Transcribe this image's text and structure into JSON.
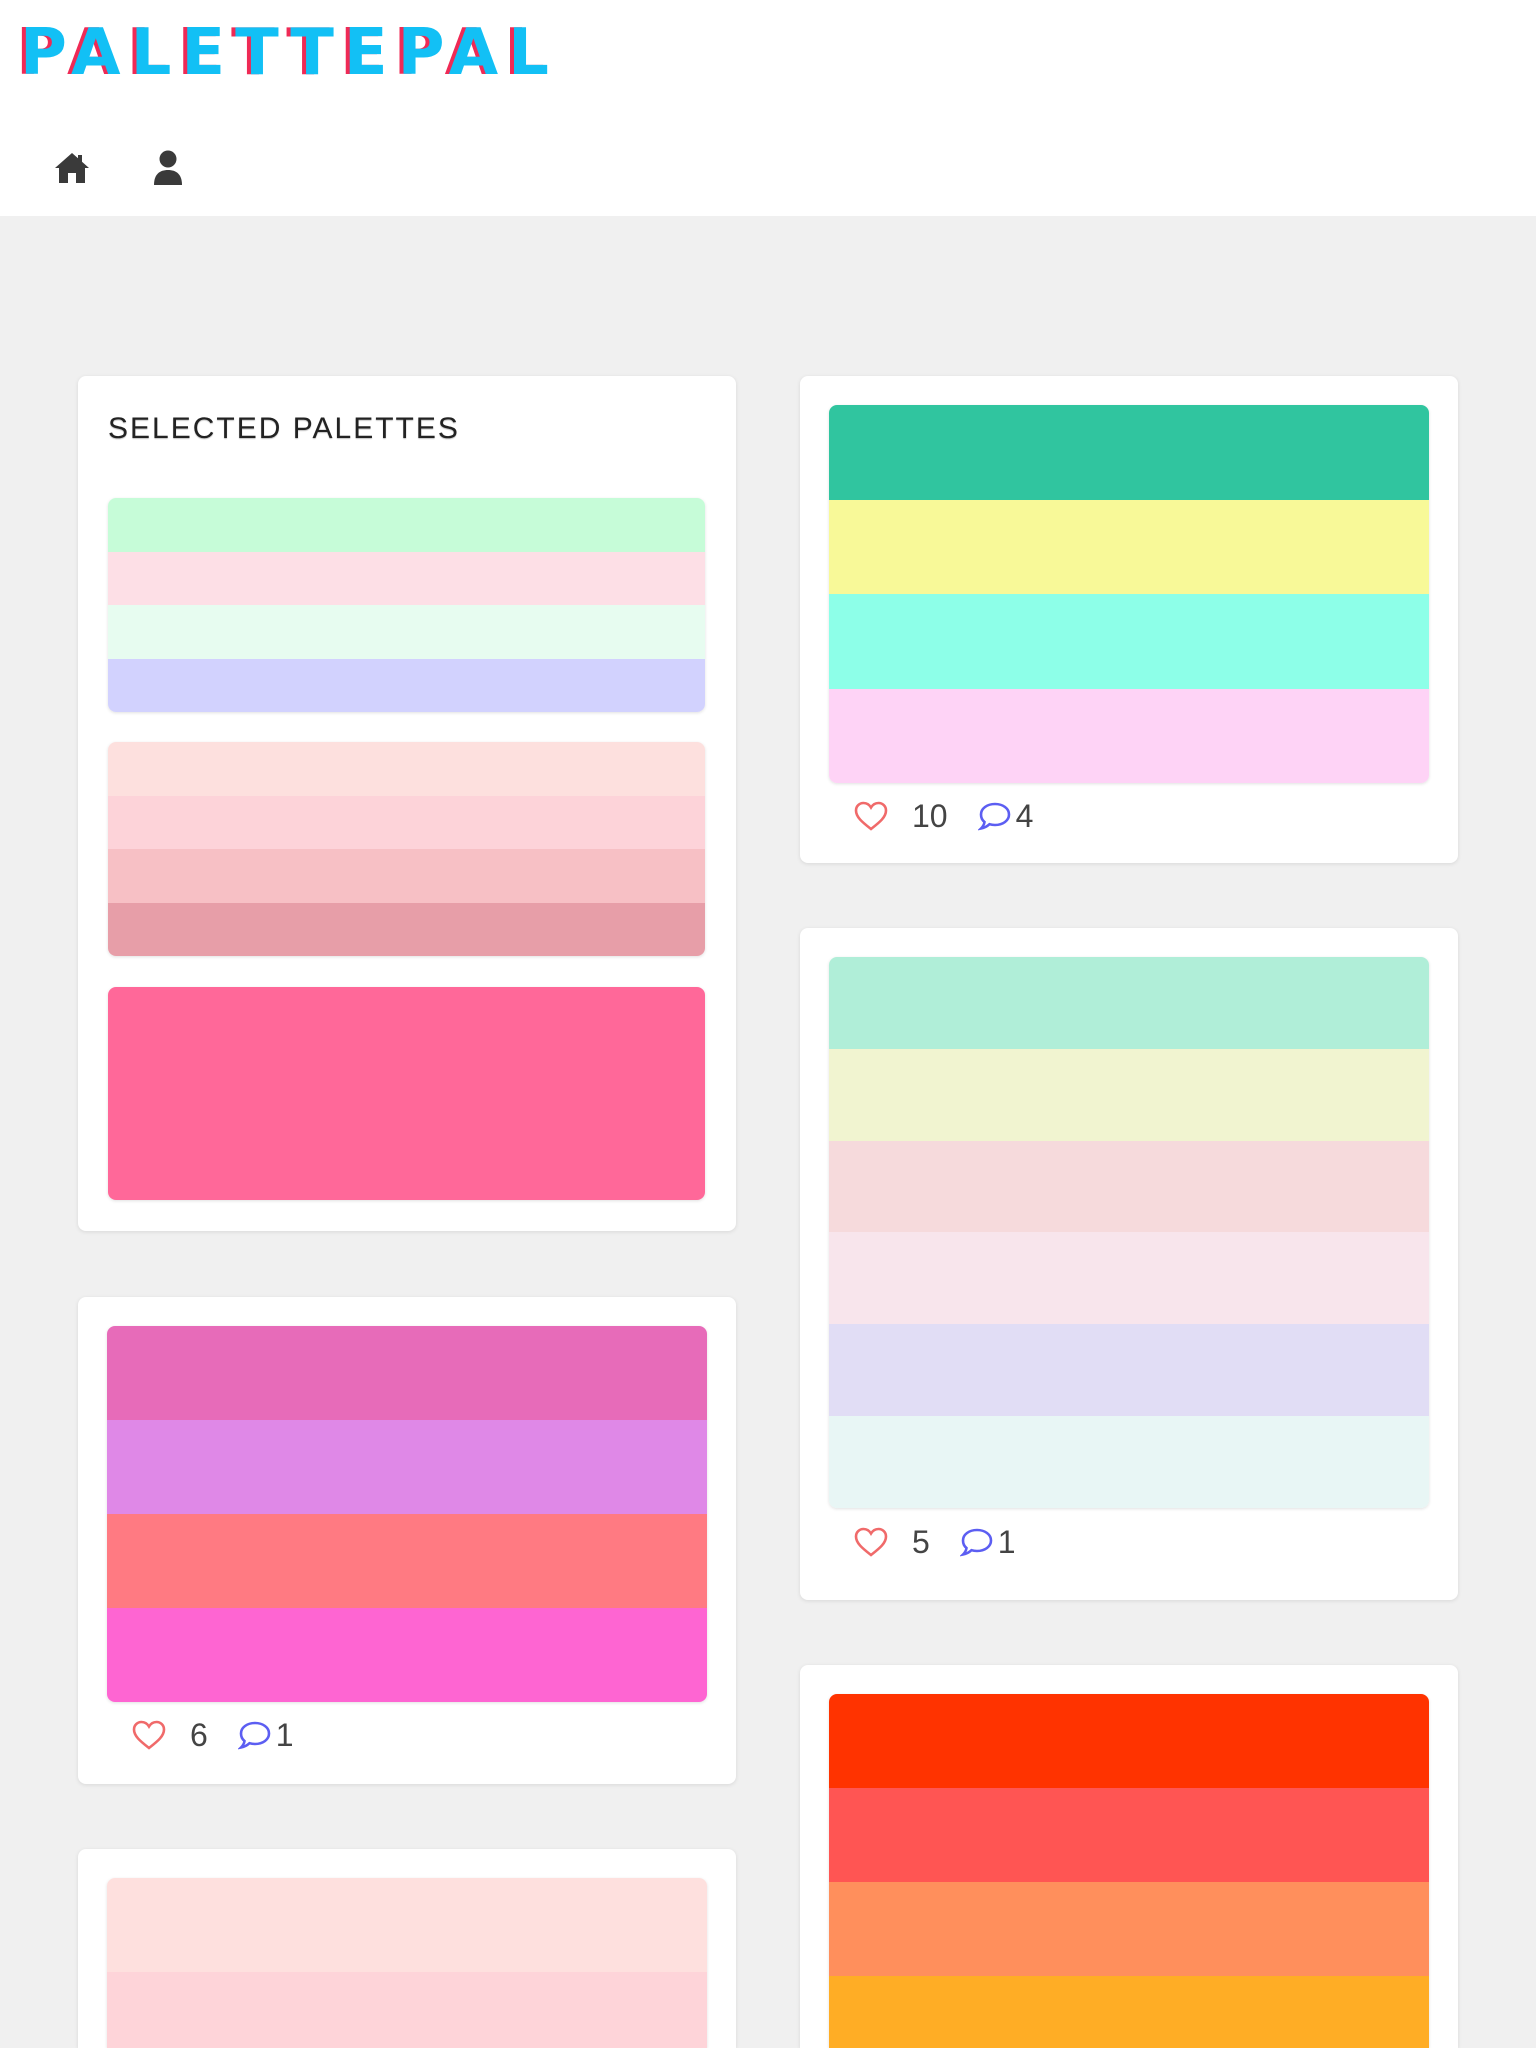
{
  "app": {
    "logo_text": "PALETTEPAL",
    "brand_colors": {
      "primary": "#12c0f5",
      "shadow": "#ef2a55"
    }
  },
  "nav": {
    "items": [
      {
        "name": "home",
        "icon": "home-icon"
      },
      {
        "name": "profile",
        "icon": "user-icon"
      }
    ]
  },
  "selected": {
    "title": "SELECTED PALETTES",
    "palettes": [
      {
        "colors": [
          "#c6fcd8",
          "#fddfe6",
          "#e7fcf0",
          "#d2d2fe"
        ]
      },
      {
        "colors": [
          "#fde0de",
          "#fdd3d9",
          "#f7c0c5",
          "#e79ea8"
        ]
      },
      {
        "colors": [
          "#ff6899"
        ]
      }
    ]
  },
  "feed": {
    "cards": [
      {
        "colors": [
          "#30c59f",
          "#f8f998",
          "#8dffe8",
          "#fed3f6"
        ],
        "likes": "10",
        "comments": "4"
      },
      {
        "colors": [
          "#b0eed8",
          "#f1f4d0",
          "#f6dadc",
          "#f8e5ec",
          "#e1ddf5",
          "#e8f6f5"
        ],
        "likes": "5",
        "comments": "1"
      },
      {
        "colors": [
          "#e76bb9",
          "#df88e7",
          "#ff7a82",
          "#fe65d2"
        ],
        "likes": "6",
        "comments": "1"
      },
      {
        "colors": [
          "#ff3300",
          "#ff5553",
          "#ff8f5c",
          "#ffad25"
        ]
      },
      {
        "colors": [
          "#fee0de",
          "#fed4d9"
        ]
      }
    ]
  },
  "icon_colors": {
    "heart": "#f06a6a",
    "comment": "#5c5ef2",
    "nav": "#3a3a3a"
  }
}
